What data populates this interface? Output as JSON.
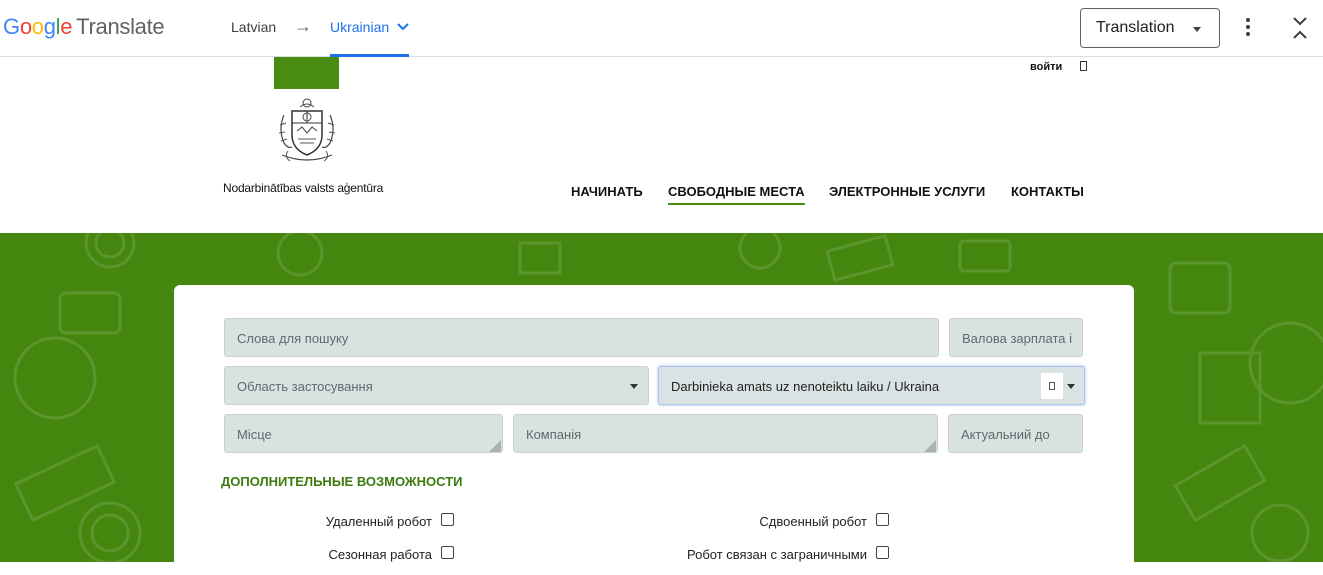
{
  "translate_bar": {
    "logo_google": [
      "G",
      "o",
      "o",
      "g",
      "l",
      "e"
    ],
    "logo_product": "Translate",
    "source_language": "Latvian",
    "arrow": "→",
    "target_language": "Ukrainian",
    "mode_select": "Translation"
  },
  "header": {
    "login_label": "войти",
    "agency_name": "Nodarbinātības valsts aģentūra",
    "nav": [
      {
        "label": "НАЧИНАТЬ"
      },
      {
        "label": "СВОБОДНЫЕ МЕСТА"
      },
      {
        "label": "ЭЛЕКТРОННЫЕ УСЛУГИ"
      },
      {
        "label": "КОНТАКТЫ"
      }
    ]
  },
  "search_form": {
    "keywords_placeholder": "Слова для пошуку",
    "salary_placeholder": "Валова зарплата і",
    "field_of_application": "Область застосування",
    "job_type_value": "Darbinieka amats uz nenoteiktu laiku / Ukraina",
    "place_placeholder": "Місце",
    "company_placeholder": "Компанія",
    "valid_until_placeholder": "Актуальний до"
  },
  "extra": {
    "title": "ДОПОЛНИТЕЛЬНЫЕ ВОЗМОЖНОСТИ",
    "checkboxes": [
      {
        "label": "Удаленный робот",
        "checked": false
      },
      {
        "label": "Сдвоенный робот",
        "checked": false
      },
      {
        "label": "Сезонная работа",
        "checked": false
      },
      {
        "label": "Робот связан с заграничными",
        "checked": false
      }
    ]
  },
  "colors": {
    "brand_green": "#45860f",
    "accent_blue": "#1a73e8",
    "field_bg": "#d7e2e1"
  }
}
